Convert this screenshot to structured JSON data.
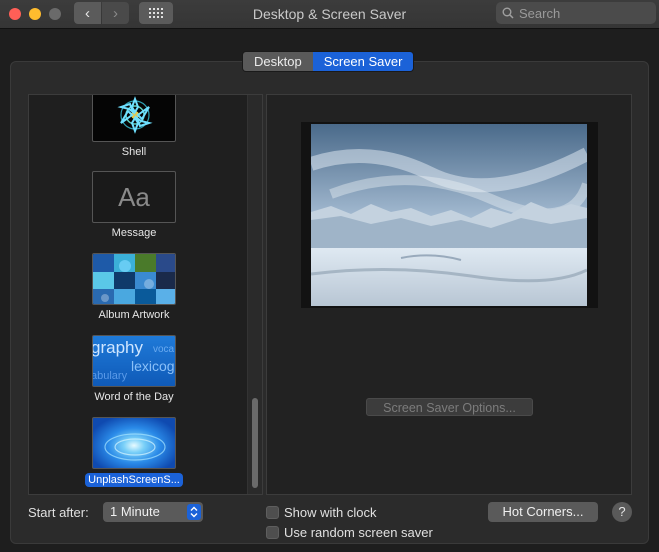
{
  "window": {
    "title": "Desktop & Screen Saver"
  },
  "search": {
    "placeholder": "Search"
  },
  "tabs": [
    {
      "label": "Desktop",
      "selected": false
    },
    {
      "label": "Screen Saver",
      "selected": true
    }
  ],
  "savers": [
    {
      "label": "Shell",
      "icon": "shell-thumbnail"
    },
    {
      "label": "Message",
      "icon": "message-thumbnail",
      "thumb_text": "Aa"
    },
    {
      "label": "Album Artwork",
      "icon": "album-artwork-thumbnail"
    },
    {
      "label": "Word of the Day",
      "icon": "word-of-the-day-thumbnail",
      "thumb_words": [
        "graphy",
        "voca",
        "lexicog",
        "abulary"
      ]
    },
    {
      "label": "UnplashScreenS...",
      "icon": "unsplash-thumbnail",
      "selected": true
    }
  ],
  "preview": {
    "options_label": "Screen Saver Options..."
  },
  "bottom": {
    "start_after_label": "Start after:",
    "start_after_value": "1 Minute",
    "show_clock_label": "Show with clock",
    "show_clock_checked": false,
    "random_label": "Use random screen saver",
    "random_checked": false,
    "hot_corners_label": "Hot Corners...",
    "help_label": "?"
  },
  "colors": {
    "accent": "#1b62d8",
    "window_bg": "#1e1e1e",
    "close": "#ff5f57",
    "minimize": "#febc2e"
  }
}
